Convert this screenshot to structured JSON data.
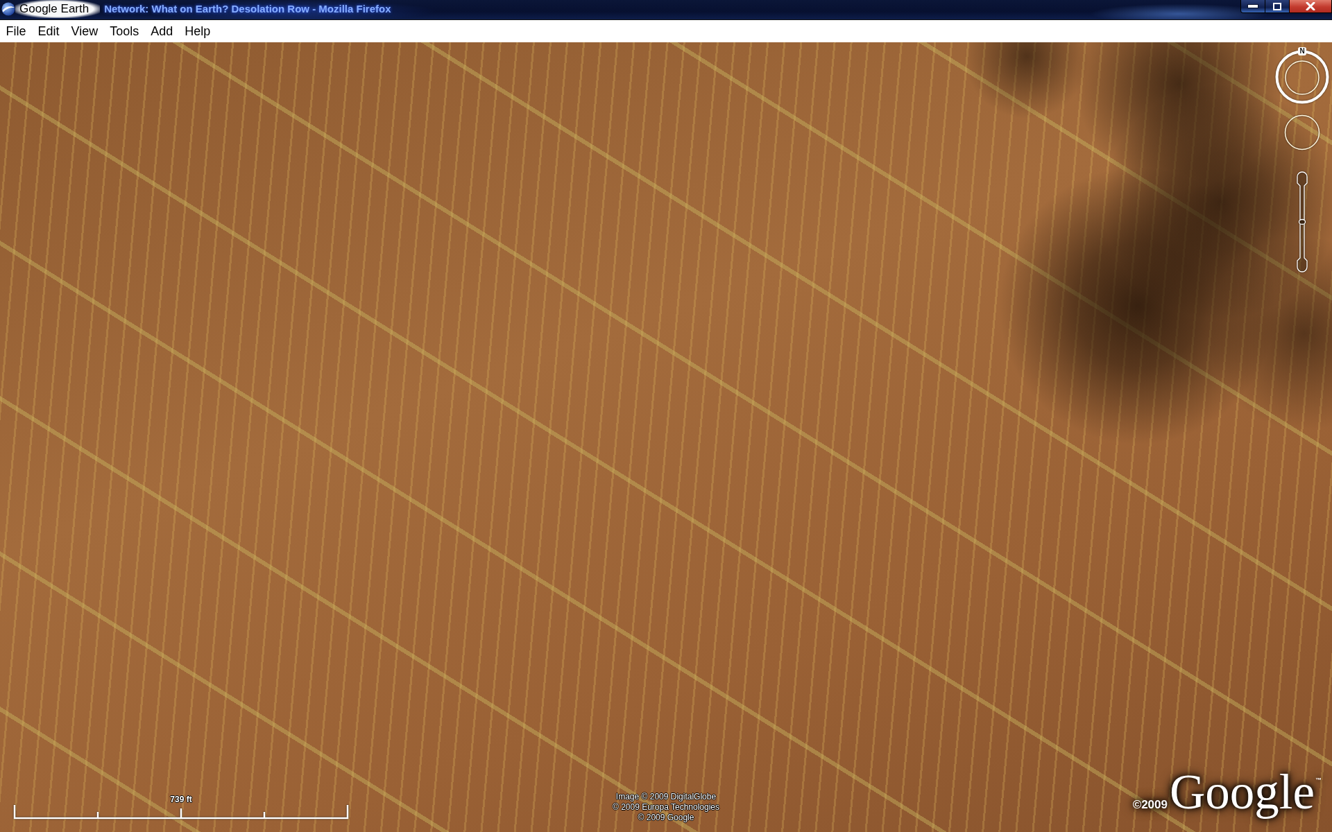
{
  "window": {
    "app_title": "Google Earth",
    "background_title": "Network: What on Earth? Desolation Row - Mozilla Firefox"
  },
  "menu": [
    "File",
    "Edit",
    "View",
    "Tools",
    "Add",
    "Help"
  ],
  "map": {
    "navigation": {
      "north_label": "N",
      "zoom_slider": {
        "level": 0.5
      }
    },
    "scale": {
      "label": "739 ft"
    },
    "attribution": [
      "Image © 2009 DigitalGlobe",
      "© 2009 Europa Technologies",
      "© 2009 Google"
    ],
    "logo": {
      "copyright": "©2009",
      "wordmark": "Google",
      "trademark": "™"
    }
  }
}
